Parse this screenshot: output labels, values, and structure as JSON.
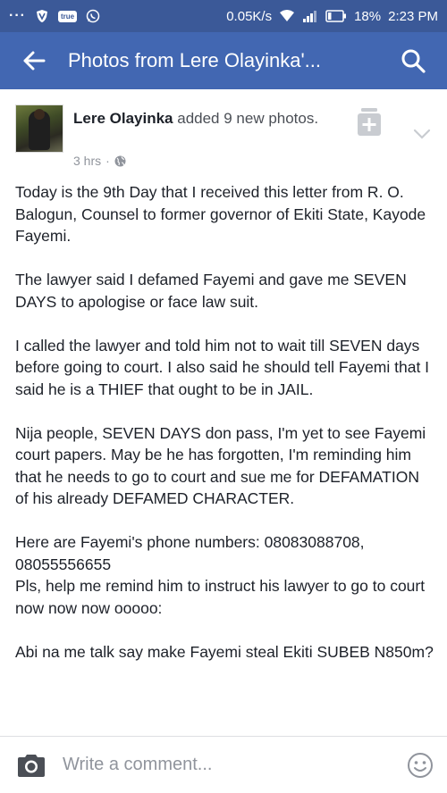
{
  "status_bar": {
    "menu_dots": "···",
    "app_badge": "true",
    "network_speed": "0.05K/s",
    "battery": "18%",
    "time": "2:23 PM"
  },
  "app_bar": {
    "title": "Photos from Lere Olayinka'..."
  },
  "post": {
    "author": "Lere Olayinka",
    "action": " added 9 new photos.",
    "time": "3 hrs",
    "separator": "·",
    "paragraphs": [
      "Today is the 9th Day that I received this letter from R. O. Balogun, Counsel to former governor of Ekiti State, Kayode Fayemi.",
      "The lawyer said I defamed Fayemi and gave me SEVEN DAYS to apologise or face law suit.",
      "I called the lawyer and told him not to wait till SEVEN days before going to court. I also said he should tell Fayemi that I said he is a THIEF that ought to be in JAIL.",
      "Nija people, SEVEN DAYS don pass, I'm yet to see Fayemi court papers. May be he has forgotten, I'm reminding him that he needs to go to court and sue me for DEFAMATION of his already DEFAMED CHARACTER.",
      "Here are Fayemi's phone numbers: 08083088708, 08055556655",
      "Pls, help me remind him to instruct his lawyer to go to court now now now ooooo:",
      "Abi na me talk say make Fayemi steal Ekiti SUBEB N850m?"
    ]
  },
  "comment_bar": {
    "placeholder": "Write a comment..."
  },
  "colors": {
    "status_bar": "#3b5998",
    "app_bar": "#4267b2",
    "text": "#1d2129",
    "meta": "#90949c"
  }
}
